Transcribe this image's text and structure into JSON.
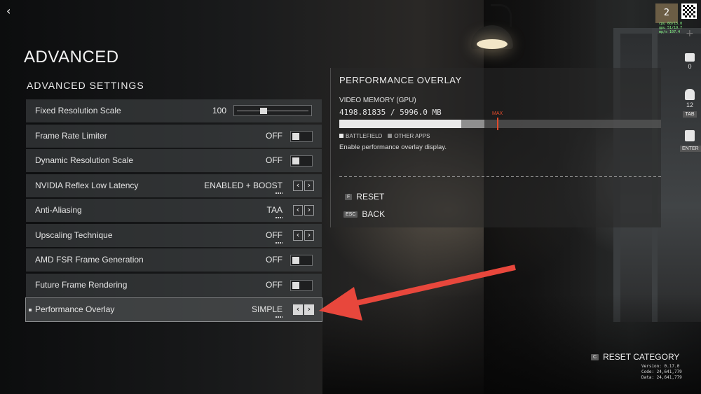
{
  "page": {
    "title": "ADVANCED",
    "section_title": "ADVANCED SETTINGS"
  },
  "settings": [
    {
      "label": "Fixed Resolution Scale",
      "control": "slider",
      "value": "100",
      "slider_fraction": 0.35
    },
    {
      "label": "Frame Rate Limiter",
      "control": "toggle",
      "value": "OFF"
    },
    {
      "label": "Dynamic Resolution Scale",
      "control": "toggle",
      "value": "OFF"
    },
    {
      "label": "NVIDIA Reflex Low Latency",
      "control": "selector",
      "value": "ENABLED + BOOST"
    },
    {
      "label": "Anti-Aliasing",
      "control": "selector",
      "value": "TAA"
    },
    {
      "label": "Upscaling Technique",
      "control": "selector",
      "value": "OFF"
    },
    {
      "label": "AMD FSR Frame Generation",
      "control": "toggle",
      "value": "OFF"
    },
    {
      "label": "Future Frame Rendering",
      "control": "toggle",
      "value": "OFF"
    },
    {
      "label": "Performance Overlay",
      "control": "selector",
      "value": "SIMPLE",
      "selected": true
    }
  ],
  "arrow_glyphs": {
    "left": "‹",
    "right": "›"
  },
  "info_panel": {
    "title": "PERFORMANCE OVERLAY",
    "vm_label": "VIDEO MEMORY (GPU)",
    "vm_value": "4198.81835 / 5996.0 MB",
    "max_label": "MAX",
    "legend_battlefield": "BATTLEFIELD",
    "legend_other": "OTHER APPS",
    "battlefield_fraction": 0.38,
    "other_fraction": 0.07,
    "max_fraction": 0.49,
    "description": "Enable performance overlay display.",
    "reset_key": "F",
    "reset_label": "RESET",
    "back_key": "ESC",
    "back_label": "BACK"
  },
  "hud": {
    "avatar_count": "2",
    "fps_lines": [
      "cpu  60/15.0",
      "gpu  51/19.7",
      "mp/s 107.4"
    ],
    "mail_count": "0",
    "squad_count": "12",
    "squad_key": "TAB",
    "enter_key": "ENTER"
  },
  "footer": {
    "reset_key": "C",
    "reset_category": "RESET CATEGORY",
    "version": "Version: 0.17.0",
    "code": "Code: 24,641,779",
    "data": "Data: 24,641,779"
  },
  "colors": {
    "accent_red": "#e34a2b",
    "annotation_arrow": "#e8473c"
  }
}
